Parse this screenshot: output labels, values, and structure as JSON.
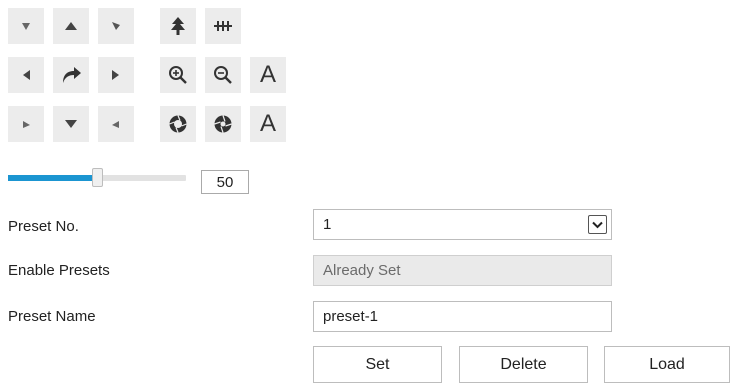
{
  "ptz": {
    "directions": [
      {
        "name": "pan-up-left-icon"
      },
      {
        "name": "tilt-up-icon"
      },
      {
        "name": "pan-up-right-icon"
      },
      {
        "name": "pan-left-icon"
      },
      {
        "name": "auto-pan-icon"
      },
      {
        "name": "pan-right-icon"
      },
      {
        "name": "pan-down-left-icon"
      },
      {
        "name": "tilt-down-icon"
      },
      {
        "name": "pan-down-right-icon"
      }
    ],
    "tools": {
      "light": "light-icon",
      "wiper": "wiper-icon",
      "zoom_in": "zoom-in-icon",
      "zoom_out": "zoom-out-icon",
      "focus_letter": "A",
      "iris_letter": "A",
      "iris_open": "iris-open-icon",
      "iris_close": "iris-close-icon"
    },
    "speed": {
      "value": "50",
      "level": 0.5
    },
    "accent": "#1b95d1"
  },
  "preset": {
    "number_label": "Preset No.",
    "number_value": "1",
    "enable_label": "Enable Presets",
    "enable_value": "Already Set",
    "name_label": "Preset Name",
    "name_value": "preset-1"
  },
  "actions": {
    "set": "Set",
    "delete": "Delete",
    "load": "Load"
  }
}
